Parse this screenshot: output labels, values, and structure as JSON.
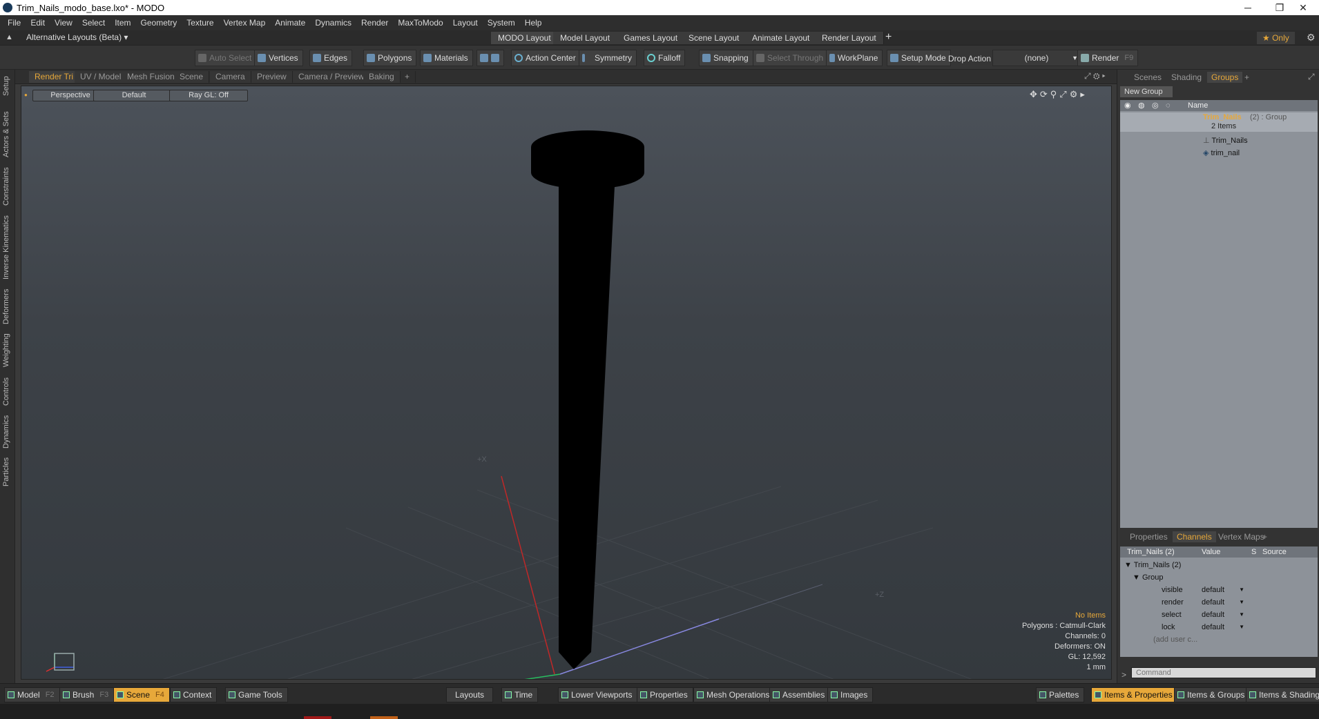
{
  "window": {
    "title": "Trim_Nails_modo_base.lxo* - MODO",
    "minimize": "─",
    "restore": "❐",
    "close": "✕"
  },
  "menu": [
    "File",
    "Edit",
    "View",
    "Select",
    "Item",
    "Geometry",
    "Texture",
    "Vertex Map",
    "Animate",
    "Dynamics",
    "Render",
    "MaxToModo",
    "Layout",
    "System",
    "Help"
  ],
  "layoutbar": {
    "alt_layouts": "Alternative Layouts (Beta) ▾",
    "tabs": [
      "MODO Layout",
      "Model Layout",
      "Games Layout",
      "Scene Layout",
      "Animate Layout",
      "Render Layout"
    ],
    "add": "+",
    "only": "★  Only"
  },
  "toolbar": {
    "auto_select": "Auto Select",
    "vertices": "Vertices",
    "edges": "Edges",
    "polygons": "Polygons",
    "materials": "Materials",
    "action_center": "Action Center",
    "symmetry": "Symmetry",
    "falloff": "Falloff",
    "snapping": "Snapping",
    "select_through": "Select Through",
    "workplane": "WorkPlane",
    "setup_mode": "Setup Mode",
    "drop_action": "Drop Action",
    "drop_value": "(none)",
    "render": "Render",
    "render_key": "F9"
  },
  "left_tabs": [
    "Setup",
    "Actors & Sets",
    "Constraints",
    "Inverse Kinematics",
    "Deformers",
    "Weighting",
    "Controls",
    "Dynamics",
    "Particles"
  ],
  "viewport_tabs": [
    "Render Tri",
    "UV / Model",
    "Mesh Fusion",
    "Scene",
    "Camera",
    "Preview",
    "Camera / Preview",
    "Baking",
    "+"
  ],
  "viewport": {
    "view": "Perspective",
    "shading": "Default",
    "raygl": "Ray GL: Off",
    "info": {
      "items": "No Items",
      "polygons": "Polygons : Catmull-Clark",
      "channels": "Channels: 0",
      "deformers": "Deformers: ON",
      "gl": "GL: 12,592",
      "unit": "1 mm"
    },
    "axis_x": "+X",
    "axis_z": "+Z"
  },
  "right_tabs": [
    "Scenes",
    "Shading",
    "Groups",
    "+"
  ],
  "groups": {
    "new_group": "New Group",
    "col_name": "Name",
    "group_name": "Trim_Nails",
    "group_suffix": "(2) : Group",
    "item_count": "2 Items",
    "children": [
      "Trim_Nails",
      "trim_nail"
    ]
  },
  "prop_tabs": [
    "Properties",
    "Channels",
    "Vertex Maps",
    "+"
  ],
  "channels": {
    "col_name": "Trim_Nails (2)",
    "col_value": "Value",
    "col_s": "S",
    "col_source": "Source",
    "root": "Trim_Nails (2)",
    "group": "Group",
    "rows": [
      {
        "name": "visible",
        "value": "default"
      },
      {
        "name": "render",
        "value": "default"
      },
      {
        "name": "select",
        "value": "default"
      },
      {
        "name": "lock",
        "value": "default"
      }
    ],
    "add_user": "(add user c...",
    "command_placeholder": "Command"
  },
  "bottom": {
    "left": [
      {
        "label": "Model",
        "key": "F2"
      },
      {
        "label": "Brush",
        "key": "F3"
      },
      {
        "label": "Scene",
        "key": "F4"
      },
      {
        "label": "Context",
        "key": ""
      },
      {
        "label": "Game Tools",
        "key": ""
      }
    ],
    "center": [
      "Layouts",
      "Time",
      "Lower Viewports",
      "Properties",
      "Mesh Operations",
      "Assemblies",
      "Images"
    ],
    "right": [
      "Palettes",
      "Items & Properties",
      "Items & Groups",
      "Items & Shading"
    ]
  },
  "colors": {
    "accent": "#e7a83a",
    "panel_bg": "#8d9299",
    "viewport_bg": "#3d4248"
  }
}
